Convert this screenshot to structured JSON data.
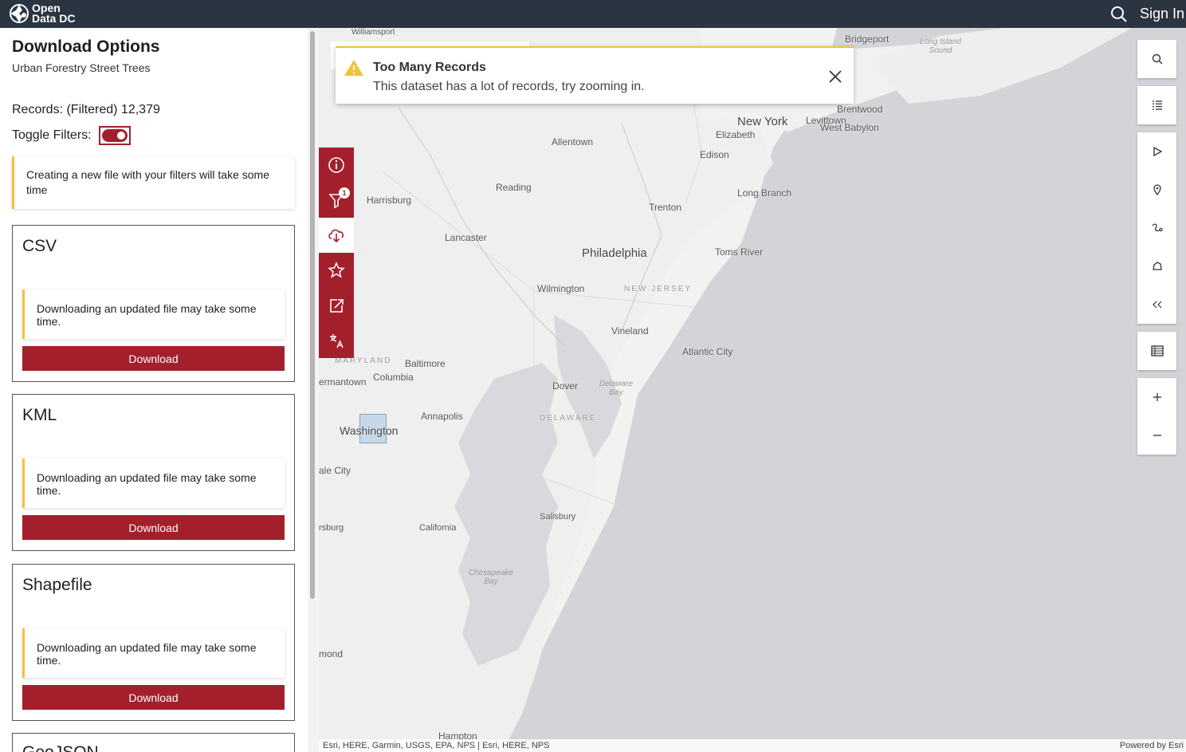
{
  "topbar": {
    "logo_line1": "Open",
    "logo_line2": "Data DC",
    "sign_in": "Sign In",
    "icons": [
      "logo-icon",
      "search-icon"
    ]
  },
  "panel": {
    "title": "Download Options",
    "subtitle": "Urban Forestry Street Trees",
    "records": "Records: (Filtered) 12,379",
    "toggle_label": "Toggle Filters:",
    "toggle_on": true,
    "notice": "Creating a new file with your filters will take some time",
    "cards": [
      {
        "title": "CSV",
        "notice": "Downloading an updated file may take some time.",
        "button": "Download"
      },
      {
        "title": "KML",
        "notice": "Downloading an updated file may take some time.",
        "button": "Download"
      },
      {
        "title": "Shapefile",
        "notice": "Downloading an updated file may take some time.",
        "button": "Download"
      },
      {
        "title": "GeoJSON"
      }
    ]
  },
  "toolbar": {
    "filter_badge": "1",
    "icons": [
      "info-icon",
      "filter-icon",
      "download-icon",
      "star-icon",
      "share-icon",
      "translate-icon"
    ],
    "active": "download-icon"
  },
  "toast": {
    "title": "Too Many Records",
    "message": "This dataset has a lot of records, try zooming in."
  },
  "map": {
    "places": {
      "williamsport": "Williamsport",
      "bridgeport": "Bridgeport",
      "long_island_sound": "Long Island Sound",
      "new_york": "New York",
      "elizabeth": "Elizabeth",
      "levittown": "Levittown",
      "brentwood": "Brentwood",
      "west_babylon": "West Babylon",
      "allentown": "Allentown",
      "edison": "Edison",
      "reading": "Reading",
      "harrisburg": "Harrisburg",
      "trenton": "Trenton",
      "long_branch": "Long Branch",
      "lancaster": "Lancaster",
      "philadelphia": "Philadelphia",
      "toms_river": "Toms River",
      "wilmington": "Wilmington",
      "new_jersey": "NEW JERSEY",
      "vineland": "Vineland",
      "atlantic_city": "Atlantic City",
      "maryland": "MARYLAND",
      "baltimore": "Baltimore",
      "germantown": "ermantown",
      "columbia": "Columbia",
      "dover": "Dover",
      "delaware_bay": "Delaware Bay",
      "annapolis": "Annapolis",
      "delaware": "DELAWARE",
      "washington": "Washington",
      "ale_city": "ale City",
      "salisbury": "Salisbury",
      "burg": "rsburg",
      "california": "California",
      "chesapeake_bay": "Chesapeake Bay",
      "mond": "mond",
      "hampton": "Hampton"
    },
    "attribution": "Esri, HERE, Garmin, USGS, EPA, NPS | Esri, HERE, NPS",
    "powered_by": "Powered by Esri"
  },
  "map_widgets": {
    "icons": [
      "map-search-icon",
      "legend-icon",
      "select-pointer-icon",
      "select-pin-icon",
      "select-line-icon",
      "select-polygon-icon",
      "collapse-icon",
      "table-icon",
      "zoom-in-icon",
      "zoom-out-icon"
    ]
  }
}
